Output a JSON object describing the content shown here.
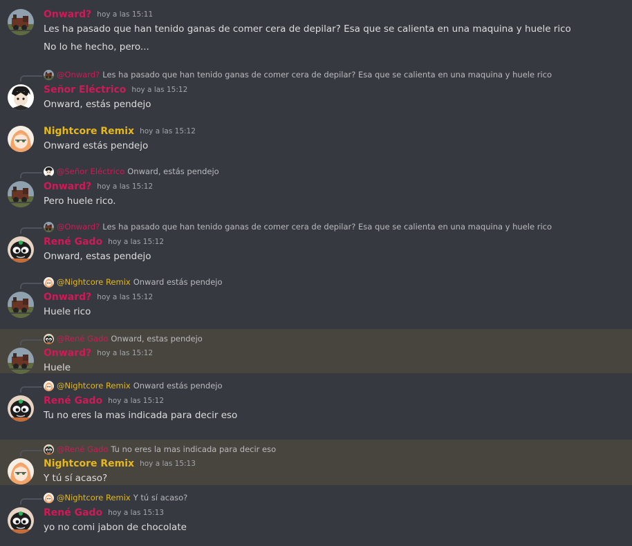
{
  "colors": {
    "onward": "#cf1a57",
    "senor": "#cf1a57",
    "nightcore": "#e6b81e",
    "rene": "#cf1a57",
    "highlight_bg": "#48453f"
  },
  "messages": [
    {
      "author": "Onward?",
      "timestamp": "hoy a las 15:11",
      "lines": [
        "Les ha pasado que han tenido ganas de comer cera de depilar? Esa que se calienta en una maquina y huele rico",
        "No lo he hecho, pero..."
      ]
    },
    {
      "reply": {
        "name": "@Onward?",
        "text": "Les ha pasado que han tenido ganas de comer cera de depilar? Esa que se calienta en una maquina y huele rico"
      },
      "author": "Señor Eléctrico",
      "timestamp": "hoy a las 15:12",
      "lines": [
        "Onward, estás pendejo"
      ]
    },
    {
      "author": "Nightcore Remix",
      "timestamp": "hoy a las 15:12",
      "lines": [
        "Onward estás pendejo"
      ]
    },
    {
      "reply": {
        "name": "@Señor Eléctrico",
        "text": "Onward, estás pendejo"
      },
      "author": "Onward?",
      "timestamp": "hoy a las 15:12",
      "lines": [
        "Pero huele rico."
      ]
    },
    {
      "reply": {
        "name": "@Onward?",
        "text": "Les ha pasado que han tenido ganas de comer cera de depilar? Esa que se calienta en una maquina y huele rico"
      },
      "author": "René Gado",
      "timestamp": "hoy a las 15:12",
      "lines": [
        "Onward, estas pendejo"
      ]
    },
    {
      "reply": {
        "name": "@Nightcore Remix",
        "text": "Onward estás pendejo"
      },
      "author": "Onward?",
      "timestamp": "hoy a las 15:12",
      "lines": [
        "Huele rico"
      ]
    },
    {
      "reply": {
        "name": "@René Gado",
        "text": "Onward, estas pendejo"
      },
      "author": "Onward?",
      "timestamp": "hoy a las 15:12",
      "lines": [
        "Huele"
      ]
    },
    {
      "reply": {
        "name": "@Nightcore Remix",
        "text": "Onward estás pendejo"
      },
      "author": "René Gado",
      "timestamp": "hoy a las 15:12",
      "lines": [
        "Tu no eres la mas indicada para decir eso"
      ]
    },
    {
      "reply": {
        "name": "@René Gado",
        "text": "Tu no eres la mas indicada para decir eso"
      },
      "author": "Nightcore Remix",
      "timestamp": "hoy a las 15:13",
      "lines": [
        "Y tú sí acaso?"
      ]
    },
    {
      "reply": {
        "name": "@Nightcore Remix",
        "text": "Y tú sí acaso?"
      },
      "author": "René Gado",
      "timestamp": "hoy a las 15:13",
      "lines": [
        "yo no comi jabon de chocolate"
      ]
    }
  ]
}
